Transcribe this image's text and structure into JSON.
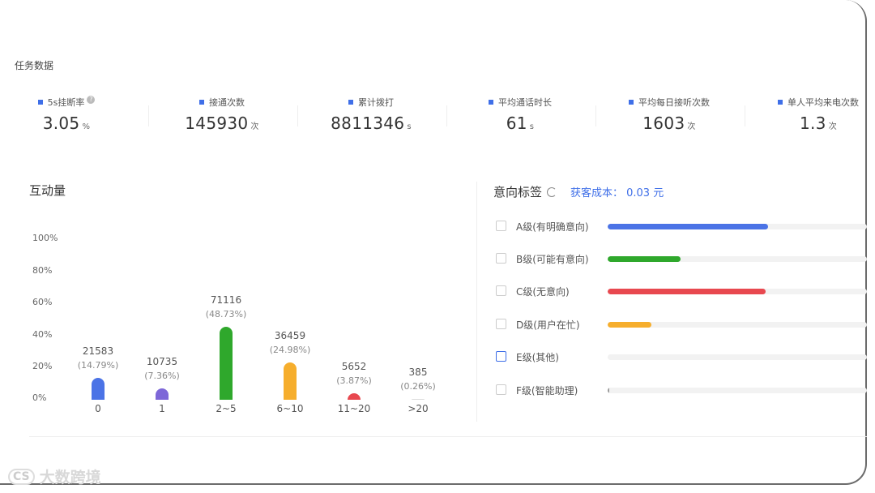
{
  "section_title": "任务数据",
  "stats": [
    {
      "label": "5s挂断率",
      "value": "3.05",
      "unit": "%",
      "help": "?"
    },
    {
      "label": "接通次数",
      "value": "145930",
      "unit": "次"
    },
    {
      "label": "累计拨打",
      "value": "8811346",
      "unit": "s"
    },
    {
      "label": "平均通话时长",
      "value": "61",
      "unit": "s"
    },
    {
      "label": "平均每日接听次数",
      "value": "1603",
      "unit": "次"
    },
    {
      "label": "单人平均来电次数",
      "value": "1.3",
      "unit": "次"
    }
  ],
  "interaction": {
    "title": "互动量",
    "y_ticks": [
      "100%",
      "80%",
      "60%",
      "40%",
      "20%",
      "0%"
    ]
  },
  "chart_data": {
    "type": "bar",
    "title": "互动量",
    "categories": [
      "0",
      "1",
      "2~5",
      "6~10",
      "11~20",
      ">20"
    ],
    "values": [
      21583,
      10735,
      71116,
      36459,
      5652,
      385
    ],
    "percent_labels": [
      "(14.79%)",
      "(7.36%)",
      "(48.73%)",
      "(24.98%)",
      "(3.87%)",
      "(0.26%)"
    ],
    "percents": [
      14.79,
      7.36,
      48.73,
      24.98,
      3.87,
      0.26
    ],
    "ylim": [
      0,
      100
    ],
    "colors": [
      "#4b73e6",
      "#7d67d8",
      "#2fa82c",
      "#f6ae2d",
      "#e8484f",
      "#dddddd"
    ]
  },
  "intent": {
    "title": "意向标签",
    "cost_text": "获客成本： 0.03 元",
    "tags": [
      {
        "label": "A级(有明确意向)",
        "fraction": 0.62,
        "color": "#4b73e6"
      },
      {
        "label": "B级(可能有意向)",
        "fraction": 0.28,
        "color": "#2fa82c"
      },
      {
        "label": "C级(无意向)",
        "fraction": 0.61,
        "color": "#e8484f"
      },
      {
        "label": "D级(用户在忙)",
        "fraction": 0.17,
        "color": "#f6ae2d"
      },
      {
        "label": "E级(其他)",
        "fraction": 0.0,
        "color": "#4b73e6"
      },
      {
        "label": "F级(智能助理)",
        "fraction": 0.005,
        "color": "#999999"
      }
    ]
  },
  "watermark": "大数跨境",
  "watermark_logo": "CS"
}
